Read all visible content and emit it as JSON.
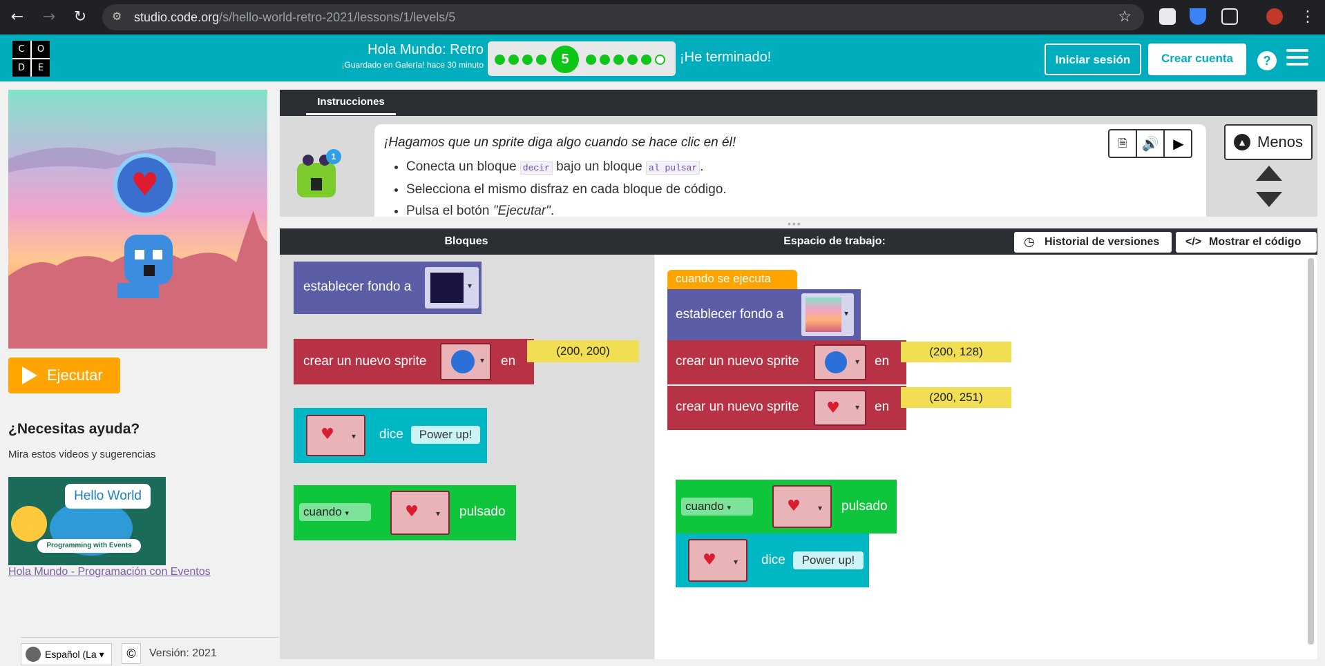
{
  "browser": {
    "url_host": "studio.code.org",
    "url_path": "/s/hello-world-retro-2021/lessons/1/levels/5"
  },
  "header": {
    "logo_letters": [
      "C",
      "O",
      "D",
      "E"
    ],
    "project_title": "Hola Mundo: Retro",
    "saved_status": "¡Guardado en Galería! hace 30 minuto",
    "current_level": "5",
    "done_label": "¡He terminado!",
    "signin_label": "Iniciar sesión",
    "create_label": "Crear cuenta",
    "help_label": "?"
  },
  "left": {
    "run_label": "Ejecutar",
    "help_title": "¿Necesitas ayuda?",
    "help_subtitle": "Mira estos videos y sugerencias",
    "video_thumb_title": "Hello World",
    "video_thumb_band": "Programming with Events",
    "video_link": "Hola Mundo - Programación con Eventos",
    "language": "Español (La",
    "copyright_icon": "©",
    "version": "Versión: 2021"
  },
  "instructions": {
    "tab": "Instrucciones",
    "heading": "¡Hagamos que un sprite diga algo cuando se hace clic en él!",
    "bullet1_pre": "Conecta un bloque",
    "bullet1_code1": "decir",
    "bullet1_mid": "bajo un bloque",
    "bullet1_code2": "al pulsar",
    "bullet1_post": ".",
    "bullet2": "Selecciona el mismo disfraz en cada bloque de código.",
    "bullet3_pre": "Pulsa el botón",
    "bullet3_em": "\"Ejecutar\"",
    "bullet3_post": ".",
    "badge": "1",
    "less_label": "Menos"
  },
  "workspace": {
    "blocks_title": "Bloques",
    "workspace_title": "Espacio de trabajo:",
    "history_label": "Historial de versiones",
    "show_code_label": "Mostrar el código"
  },
  "toolbox_blocks": {
    "set_bg": "establecer fondo a",
    "make_sprite": "crear un nuevo sprite",
    "at": "en",
    "pos": "(200, 200)",
    "says": "dice",
    "say_text": "Power up!",
    "when": "cuando",
    "clicked": "pulsado"
  },
  "canvas_blocks": {
    "when_run": "cuando se ejecuta",
    "set_bg": "establecer fondo a",
    "make_sprite1": "crear un nuevo sprite",
    "at1": "en",
    "pos1": "(200, 128)",
    "make_sprite2": "crear un nuevo sprite",
    "at2": "en",
    "pos2": "(200, 251)",
    "when": "cuando",
    "clicked": "pulsado",
    "says": "dice",
    "say_text": "Power up!"
  },
  "colors": {
    "header": "#00adbc",
    "run_button": "#ffa400",
    "block_purple": "#5b5ea6",
    "block_red": "#b73244",
    "block_teal": "#00b7c4",
    "block_green": "#0ec53b",
    "block_orange": "#ffa400",
    "progress_green": "#0ec61a"
  },
  "icons": [
    "back-icon",
    "forward-icon",
    "reload-icon",
    "tune-icon",
    "star-icon",
    "extension-icon",
    "menu-icon",
    "play-icon",
    "speaker-icon",
    "chevron-up-icon",
    "chevron-down-icon",
    "clock-icon",
    "code-icon",
    "globe-icon",
    "heart-sprite-icon",
    "blue-sprite-icon"
  ]
}
